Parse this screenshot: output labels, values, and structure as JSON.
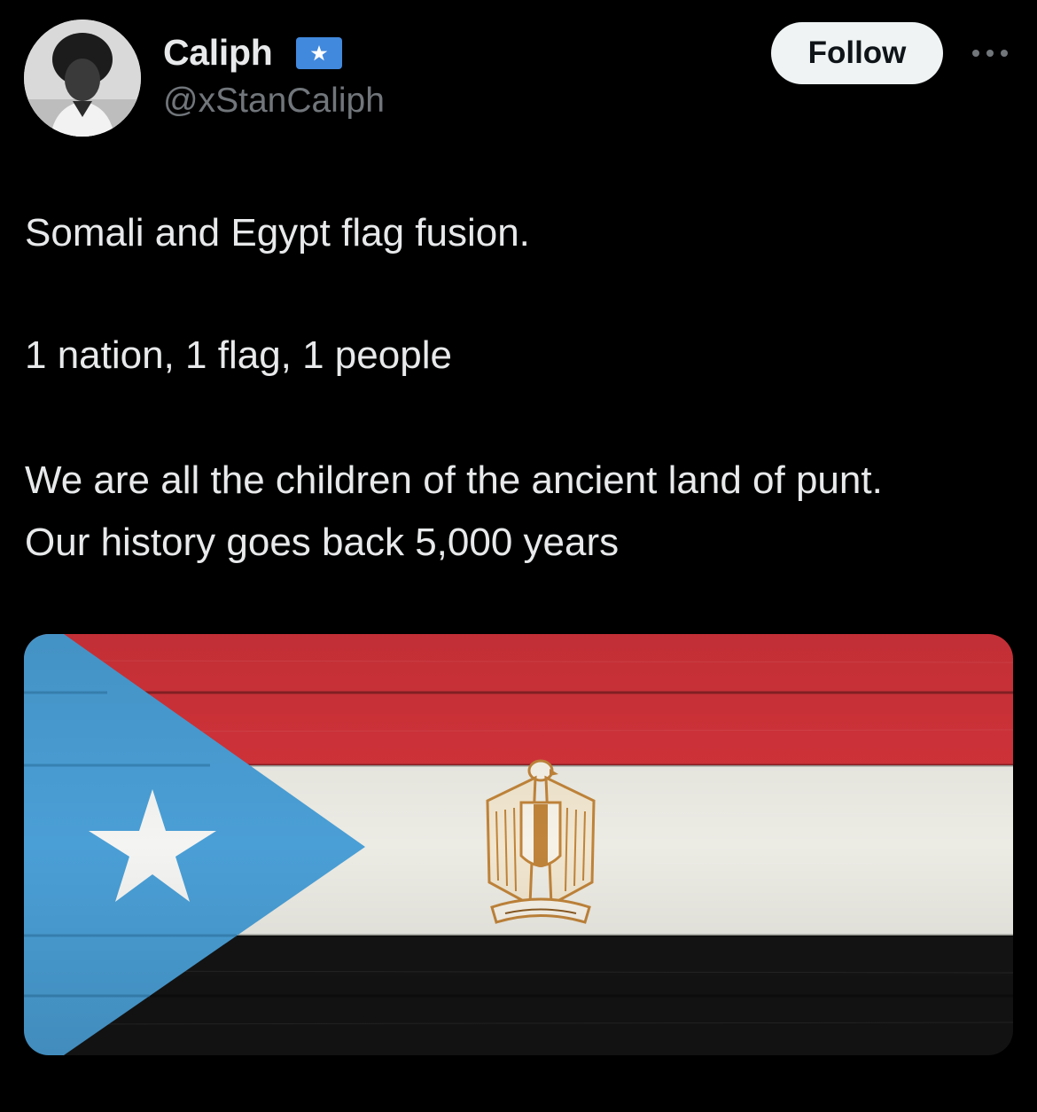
{
  "author": {
    "display_name": "Caliph",
    "handle": "@xStanCaliph",
    "name_flag_icon": "somalia-flag-icon"
  },
  "actions": {
    "follow_label": "Follow",
    "more_icon": "more-dots-icon"
  },
  "tweet": {
    "paragraphs": [
      "Somali and Egypt flag fusion.",
      "1 nation, 1 flag, 1 people",
      "We are all the children of the ancient land of punt. Our history goes back 5,000 years"
    ]
  },
  "media": {
    "description_icon": "flag-fusion-image",
    "colors": {
      "red": "#d3333a",
      "white": "#ecebe4",
      "black": "#141414",
      "blue": "#4a9fd6",
      "eagle": "#c0843a"
    }
  },
  "theme": {
    "background": "#000000",
    "text": "#e7e9ea",
    "secondary_text": "#71767b",
    "button_bg": "#eff3f4"
  }
}
